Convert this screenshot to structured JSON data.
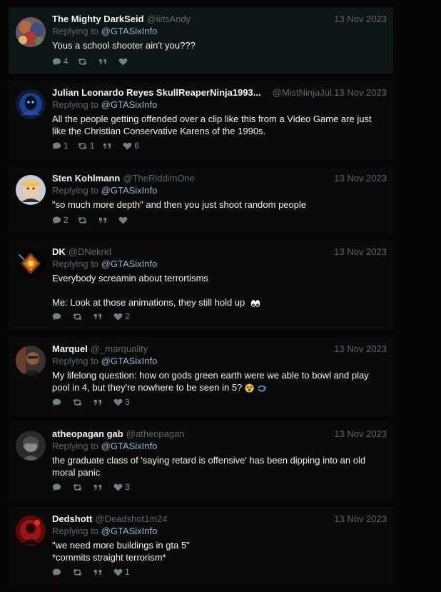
{
  "mention": "@GTASixInfo",
  "replying_prefix": "Replying to",
  "tweets": [
    {
      "name": "The Mighty DarkSeid",
      "handle": "@iiitsAndy",
      "date": "13 Nov 2023",
      "text": "Yous a school shooter ain't you???",
      "replies": "4",
      "retweets": "",
      "quotes": "",
      "likes": ""
    },
    {
      "name": "Julian Leonardo Reyes SkullReaperNinja1993...",
      "handle": "@MistNinjaJul...",
      "date": "13 Nov 2023",
      "text": "All the people getting offended over a clip like this from a Video Game are just like the Christian Conservative Karens of the 1990s.",
      "replies": "1",
      "retweets": "1",
      "quotes": "",
      "likes": "6"
    },
    {
      "name": "Sten Kohlmann",
      "handle": "@TheRiddimOne",
      "date": "13 Nov 2023",
      "text": "\"so much more depth\" and then you just shoot random people",
      "replies": "2",
      "retweets": "",
      "quotes": "",
      "likes": ""
    },
    {
      "name": "DK",
      "handle": "@DNekrid",
      "date": "13 Nov 2023",
      "text": "Everybody screamin about terrortisms\n\nMe: Look at those animations, they still hold up",
      "replies": "",
      "retweets": "",
      "quotes": "",
      "likes": "2"
    },
    {
      "name": "Marquel",
      "handle": "@_marquality",
      "date": "13 Nov 2023",
      "text": "My lifelong question: how on gods green earth were we able to bowl and play pool in 4, but they're nowhere to be seen in 5?",
      "replies": "",
      "retweets": "",
      "quotes": "",
      "likes": "3"
    },
    {
      "name": "atheopagan gab",
      "handle": "@atheopagan",
      "date": "13 Nov 2023",
      "text": "the graduate class of 'saying retard is offensive' has been dipping into an old moral panic",
      "replies": "",
      "retweets": "",
      "quotes": "",
      "likes": "3"
    },
    {
      "name": "Dedshott",
      "handle": "@Deadshot1m24",
      "date": "13 Nov 2023",
      "text": "\"we need more buildings in gta 5\"\n*commits straight terrorism*",
      "replies": "",
      "retweets": "",
      "quotes": "",
      "likes": "1"
    }
  ],
  "icons": {
    "reply": "speech-bubble-icon",
    "retweet": "retweet-icon",
    "quote": "quote-icon",
    "like": "heart-icon"
  },
  "colors": {
    "background": "#050505",
    "card": "#0a0a0a",
    "highlighted_card": "#0d1617",
    "mention": "#8fb6cf",
    "muted": "#5b6670"
  }
}
